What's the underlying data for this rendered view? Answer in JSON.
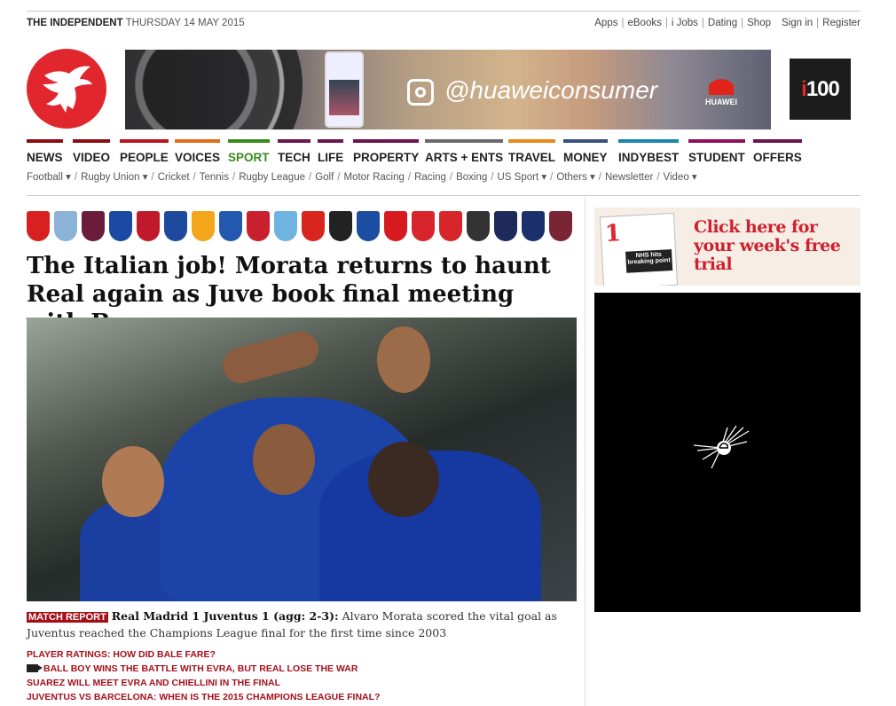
{
  "topbar": {
    "brand": "THE INDEPENDENT",
    "date": "THURSDAY 14 MAY 2015",
    "links": [
      "Apps",
      "eBooks",
      "i Jobs",
      "Dating",
      "Shop"
    ],
    "sign_in": "Sign in",
    "register": "Register"
  },
  "ad": {
    "handle": "@huaweiconsumer",
    "brand": "HUAWEI"
  },
  "i100": {
    "prefix": "i",
    "number": "100"
  },
  "nav": [
    {
      "label": "NEWS",
      "color": "#8b0d12"
    },
    {
      "label": "VIDEO",
      "color": "#8b0d12"
    },
    {
      "label": "PEOPLE",
      "color": "#b8141e"
    },
    {
      "label": "VOICES",
      "color": "#e46a1c"
    },
    {
      "label": "SPORT",
      "color": "#3b8a1e"
    },
    {
      "label": "TECH",
      "color": "#6b1652"
    },
    {
      "label": "LIFE",
      "color": "#6b1652"
    },
    {
      "label": "PROPERTY",
      "color": "#6b1652"
    },
    {
      "label": "ARTS + ENTS",
      "color": "#6b6b6b"
    },
    {
      "label": "TRAVEL",
      "color": "#e88a1a"
    },
    {
      "label": "MONEY",
      "color": "#3a5080"
    },
    {
      "label": "INDYBEST",
      "color": "#1985b0"
    },
    {
      "label": "STUDENT",
      "color": "#8b1060"
    },
    {
      "label": "OFFERS",
      "color": "#6b1652"
    }
  ],
  "subnav": [
    "Football ▾",
    "Rugby Union ▾",
    "Cricket",
    "Tennis",
    "Rugby League",
    "Golf",
    "Motor Racing",
    "Racing",
    "Boxing",
    "US Sport ▾",
    "Others ▾",
    "Newsletter",
    "Video ▾"
  ],
  "club_badges": [
    {
      "name": "arsenal",
      "color": "#d7201f"
    },
    {
      "name": "aston-villa",
      "color": "#8bb3d8"
    },
    {
      "name": "burnley",
      "color": "#6b1c3a"
    },
    {
      "name": "chelsea",
      "color": "#1a4aa3"
    },
    {
      "name": "crystal-palace",
      "color": "#c0192c"
    },
    {
      "name": "everton",
      "color": "#1d4a9e"
    },
    {
      "name": "hull-city",
      "color": "#f3a51c"
    },
    {
      "name": "leicester-city",
      "color": "#2458b0"
    },
    {
      "name": "liverpool",
      "color": "#c8202f"
    },
    {
      "name": "manchester-city",
      "color": "#6fb3e0"
    },
    {
      "name": "manchester-united",
      "color": "#d9251e"
    },
    {
      "name": "newcastle-united",
      "color": "#222222"
    },
    {
      "name": "qpr",
      "color": "#1b4da0"
    },
    {
      "name": "southampton",
      "color": "#d71920"
    },
    {
      "name": "stoke-city",
      "color": "#d8242c"
    },
    {
      "name": "sunderland",
      "color": "#d7252b"
    },
    {
      "name": "swansea-city",
      "color": "#333333"
    },
    {
      "name": "tottenham",
      "color": "#1d2a5a"
    },
    {
      "name": "west-brom",
      "color": "#1b2f6b"
    },
    {
      "name": "west-ham",
      "color": "#7a2536"
    }
  ],
  "article": {
    "headline": "The Italian job! Morata returns to haunt Real again as Juve book final meeting with Barca",
    "tag": "MATCH REPORT",
    "lead": "Real Madrid 1 Juventus 1 (agg: 2-3):",
    "summary": " Alvaro Morata scored the vital goal as Juventus reached the Champions League final for the first time since 2003",
    "related": [
      "PLAYER RATINGS: HOW DID BALE FARE?",
      "BALL BOY WINS THE BATTLE WITH EVRA, BUT REAL LOSE THE WAR",
      "SUAREZ WILL MEET EVRA AND CHIELLINI IN THE FINAL",
      "JUVENTUS VS BARCELONA: WHEN IS THE 2015 CHAMPIONS LEAGUE FINAL?"
    ]
  },
  "promo": {
    "cta": "Click here for your week's free trial",
    "paper_number": "1",
    "paper_headline": "NHS hits breaking point"
  },
  "video_player": {
    "icon": "esprit-star-logo"
  }
}
